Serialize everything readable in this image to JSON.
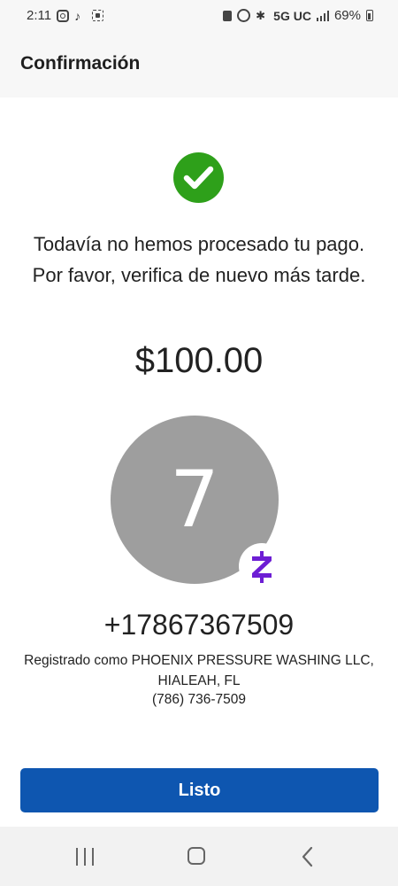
{
  "status_bar": {
    "time": "2:11",
    "network": "5G UC",
    "battery": "69%",
    "icons": [
      "instagram-icon",
      "tiktok-icon",
      "screenshot-icon",
      "lock-icon",
      "alarm-icon",
      "bluetooth-icon",
      "signal-icon",
      "battery-icon"
    ]
  },
  "header": {
    "title": "Confirmación"
  },
  "confirmation": {
    "status_icon": "check-circle-icon",
    "message": "Todavía no hemos procesado tu pago. Por favor, verifica de nuevo más tarde.",
    "amount": "$100.00"
  },
  "recipient": {
    "avatar_initial": "7",
    "badge_icon": "zelle-icon",
    "phone": "+17867367509",
    "registered_as": "Registrado como PHOENIX PRESSURE WASHING LLC, HIALEAH, FL",
    "contact_phone": "(786) 736-7509"
  },
  "actions": {
    "done_label": "Listo"
  },
  "nav_bar": {
    "icons": [
      "recents-icon",
      "home-icon",
      "back-icon"
    ]
  },
  "colors": {
    "success_green": "#2ea01a",
    "primary_blue": "#0e56b0",
    "zelle_purple": "#6d1ed4",
    "avatar_gray": "#9e9e9e"
  }
}
